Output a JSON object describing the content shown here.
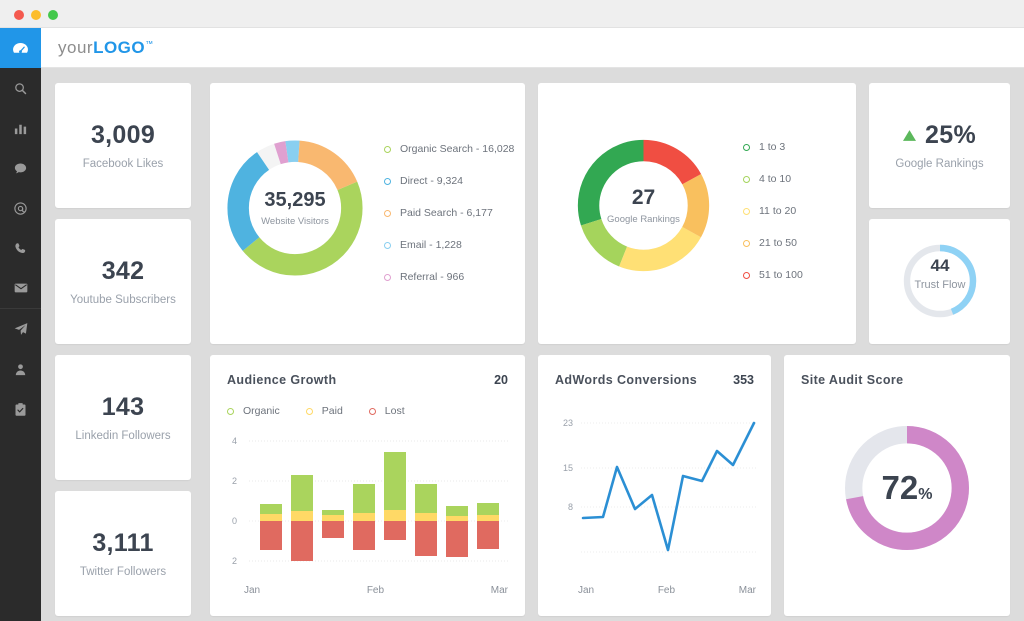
{
  "window": {
    "lights": [
      "close",
      "minimize",
      "zoom"
    ]
  },
  "header": {
    "logo_prefix": "your",
    "logo_main": "LOGO",
    "logo_tm": "™"
  },
  "sidebar": {
    "items": [
      {
        "icon": "dashboard-icon",
        "active": true
      },
      {
        "icon": "search-icon"
      },
      {
        "icon": "bar-chart-icon"
      },
      {
        "icon": "chat-bubble-icon"
      },
      {
        "icon": "at-sign-icon"
      },
      {
        "icon": "phone-icon"
      },
      {
        "icon": "envelope-icon"
      },
      {
        "icon": "paper-plane-icon"
      },
      {
        "icon": "person-icon"
      },
      {
        "icon": "clipboard-check-icon"
      }
    ]
  },
  "kpis": [
    {
      "value": "3,009",
      "label": "Facebook Likes"
    },
    {
      "value": "342",
      "label": "Youtube Subscribers"
    },
    {
      "value": "143",
      "label": "Linkedin Followers"
    },
    {
      "value": "3,111",
      "label": "Twitter Followers"
    }
  ],
  "google_rankings_delta": {
    "icon": "triangle-up-icon",
    "value": "25%",
    "label": "Google Rankings",
    "color": "#5cb85c"
  },
  "trust_flow": {
    "value": "44",
    "label": "Trust Flow",
    "percent": 44,
    "arc_color": "#8fd2f5",
    "track_color": "#e4e7ec"
  },
  "site_audit": {
    "title": "Site Audit Score",
    "value": "72",
    "suffix": "%",
    "percent": 72,
    "arc_color": "#cf87c8",
    "track_color": "#e4e6ec"
  },
  "chart_data": [
    {
      "type": "pie",
      "name": "website-visitors-donut",
      "title": "Website Visitors",
      "center_value": "35,295",
      "center_label": "Website Visitors",
      "total": 35295,
      "labels": [
        "Organic Search",
        "Direct",
        "Paid Search",
        "Email",
        "Referral"
      ],
      "values": [
        16028,
        9324,
        6177,
        1228,
        966
      ],
      "value_labels": [
        "16,028",
        "9,324",
        "6,177",
        "1,228",
        "966"
      ],
      "legend_entries": [
        "Organic Search - 16,028",
        "Direct - 9,324",
        "Paid Search - 6,177",
        "Email - 1,228",
        "Referral - 966"
      ],
      "colors": [
        "#aad45d",
        "#4fb3e0",
        "#f9b870",
        "#89cff0",
        "#e0a0d0"
      ],
      "legend_position": "right"
    },
    {
      "type": "pie",
      "name": "google-rankings-donut",
      "title": "Google Rankings",
      "center_value": "27",
      "center_label": "Google Rankings",
      "labels": [
        "1 to 3",
        "4 to 10",
        "11 to 20",
        "21 to 50",
        "51 to 100"
      ],
      "values": [
        30,
        14,
        23,
        16,
        17
      ],
      "legend_entries": [
        "1 to 3",
        "4 to 10",
        "11 to 20",
        "21 to 50",
        "51 to 100"
      ],
      "colors": [
        "#32a852",
        "#a5d45c",
        "#ffe075",
        "#f9c05e",
        "#f04e42"
      ],
      "legend_position": "right"
    },
    {
      "type": "bar",
      "name": "audience-growth-chart",
      "title": "Audience Growth",
      "value_badge": "20",
      "stacked": true,
      "categories": [
        "1",
        "2",
        "3",
        "4",
        "5",
        "6",
        "7",
        "8"
      ],
      "x_tick_labels": [
        "Jan",
        "Feb",
        "Mar"
      ],
      "y_tick_labels": [
        "4",
        "2",
        "0",
        "2"
      ],
      "y_tick_values": [
        4,
        2,
        0,
        -2
      ],
      "ylim": [
        -2,
        4
      ],
      "grid": true,
      "legend_position": "top",
      "series": [
        {
          "name": "Organic",
          "color": "#aad45d",
          "values": [
            0.85,
            2.3,
            0.55,
            1.85,
            3.45,
            1.85,
            0.75,
            0.9
          ]
        },
        {
          "name": "Paid",
          "color": "#ffd966",
          "values": [
            0.35,
            0.5,
            0.3,
            0.4,
            0.55,
            0.4,
            0.25,
            0.3
          ]
        },
        {
          "name": "Lost",
          "color": "#e06a60",
          "values": [
            -1.45,
            -2.0,
            -0.85,
            -1.45,
            -0.95,
            -1.75,
            -1.8,
            -1.4
          ]
        }
      ]
    },
    {
      "type": "line",
      "name": "adwords-conversions-chart",
      "title": "AdWords Conversions",
      "value_badge": "353",
      "x_tick_labels": [
        "Jan",
        "Feb",
        "Mar"
      ],
      "y_tick_labels": [
        "23",
        "15",
        "8"
      ],
      "y_tick_values": [
        23,
        15,
        8
      ],
      "ylim": [
        0,
        24
      ],
      "grid": true,
      "line_color": "#2b8fd4",
      "series": [
        {
          "name": "Conversions",
          "x": [
            0,
            1,
            2,
            3,
            4,
            5,
            6,
            7,
            8,
            9,
            10,
            11,
            12,
            13
          ],
          "values": [
            6.0,
            6.1,
            15.0,
            7.0,
            9.4,
            1.0,
            13.0,
            12.5,
            17.0,
            15.6,
            23.0,
            23.0,
            23.0,
            23.0
          ]
        }
      ]
    }
  ]
}
